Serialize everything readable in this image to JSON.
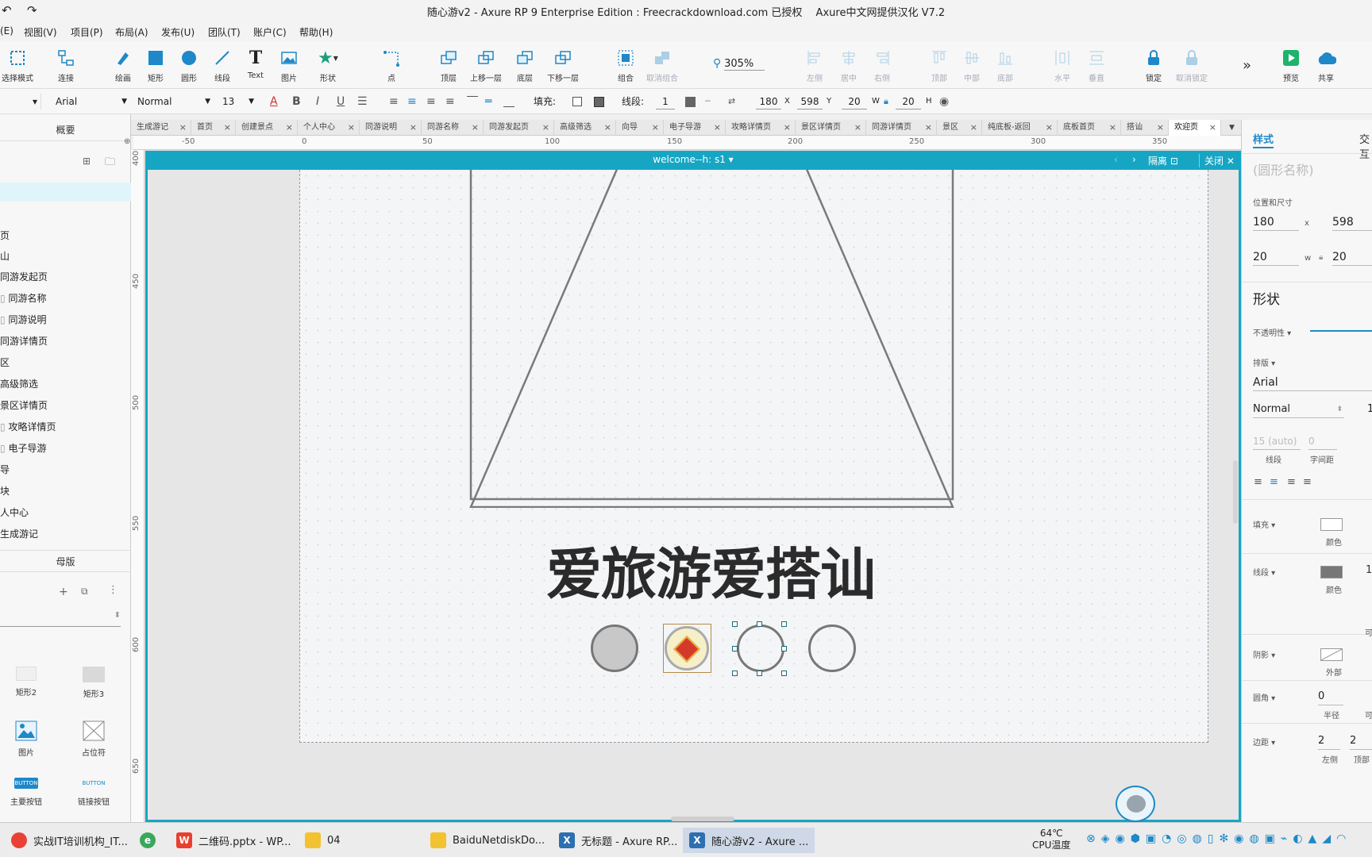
{
  "window": {
    "title": "随心游v2 - Axure RP 9 Enterprise Edition : Freecrackdownload.com 已授权　 Axure中文网提供汉化 V7.2"
  },
  "menu": [
    "(E)",
    "视图(V)",
    "项目(P)",
    "布局(A)",
    "发布(U)",
    "团队(T)",
    "账户(C)",
    "帮助(H)"
  ],
  "toolbar": {
    "select_mode": "选择模式",
    "connect": "连接",
    "draw": "绘画",
    "rect": "矩形",
    "circle": "圆形",
    "line": "线段",
    "text": "Text",
    "image": "图片",
    "shape": "形状",
    "point": "点",
    "top_layer": "顶层",
    "up_layer": "上移一层",
    "bottom_layer": "底层",
    "down_layer": "下移一层",
    "group": "组合",
    "ungroup": "取消组合",
    "zoom": "305%",
    "align_left": "左侧",
    "align_center": "居中",
    "align_right": "右侧",
    "align_top": "顶部",
    "align_middle": "中部",
    "align_bottom": "底部",
    "dist_h": "水平",
    "dist_v": "垂直",
    "lock": "锁定",
    "unlock": "取消锁定",
    "preview": "预览",
    "share": "共享"
  },
  "format": {
    "font": "Arial",
    "style": "Normal",
    "size": "13",
    "fill_label": "填充:",
    "line_label": "线段:",
    "line_width": "1",
    "x": "180",
    "x_label": "X",
    "y": "598",
    "y_label": "Y",
    "w": "20",
    "w_label": "W",
    "h": "20",
    "h_label": "H"
  },
  "left": {
    "outline_title": "概要",
    "pages": [
      "页",
      "山",
      "同游发起页",
      "同游名称",
      "同游说明",
      "同游详情页",
      "区",
      "高级筛选",
      "景区详情页",
      "攻略详情页",
      "电子导游",
      "导",
      "块",
      "人中心",
      "生成游记"
    ],
    "masters_title": "母版",
    "widgets": [
      "矩形2",
      "矩形3",
      "图片",
      "占位符",
      "主要按钮",
      "链接按钮"
    ]
  },
  "tabs": [
    "生成游记",
    "首页",
    "创建景点",
    "个人中心",
    "同游说明",
    "同游名称",
    "同游发起页",
    "高级筛选",
    "向导",
    "电子导游",
    "攻略详情页",
    "景区详情页",
    "同游详情页",
    "景区",
    "纯底板-返回",
    "底板首页",
    "搭讪",
    "欢迎页"
  ],
  "ruler": {
    "h": [
      "-50",
      "0",
      "50",
      "100",
      "150",
      "200",
      "250",
      "300",
      "350"
    ],
    "v": [
      "400",
      "450",
      "500",
      "550",
      "600",
      "650"
    ]
  },
  "preview": {
    "title": "welcome--h: s1",
    "isolate": "隔离",
    "close": "关闭"
  },
  "page": {
    "slogan": "爱旅游爱搭讪"
  },
  "right": {
    "tab_style": "样式",
    "tab_interact": "交互",
    "shape_name_placeholder": "(圆形名称)",
    "pos_size_label": "位置和尺寸",
    "x": "180",
    "x_label": "x",
    "y": "598",
    "w": "20",
    "w_label": "w",
    "h": "20",
    "shape_title": "形状",
    "opacity_label": "不透明性",
    "typography_label": "排版",
    "font": "Arial",
    "style": "Normal",
    "style_size": "1",
    "line_height": "15 (auto)",
    "line_height_label": "线段",
    "letter_spacing": "0",
    "letter_spacing_label": "字间距",
    "fill_label": "填充",
    "fill_color_label": "颜色",
    "stroke_label": "线段",
    "stroke_color_label": "颜色",
    "stroke_width": "1",
    "shadow_label": "阴影",
    "shadow_outer": "外部",
    "corner_label": "圆角",
    "corner_value": "0",
    "corner_radius": "半径",
    "corner_extra": "可",
    "padding_label": "边距",
    "padding_left": "2",
    "padding_top": "2",
    "padding_left_label": "左侧",
    "padding_top_label": "顶部",
    "extra_label": "可"
  },
  "taskbar": {
    "items": [
      "实战IT培训机构_IT...",
      "",
      "二维码.pptx - WP...",
      "04",
      "BaiduNetdiskDo...",
      "无标题 - Axure RP...",
      "随心游v2 - Axure ..."
    ],
    "temp": "64℃",
    "temp_label": "CPU温度"
  },
  "colors": {
    "accent": "#16a6c4",
    "slogan": "#2b2b2b",
    "dot_filled": "#c8c8c8",
    "badge": "#f5f0c8"
  },
  "icons": {
    "selected_circle": "selected-circle",
    "badge": "fu-badge-icon"
  }
}
